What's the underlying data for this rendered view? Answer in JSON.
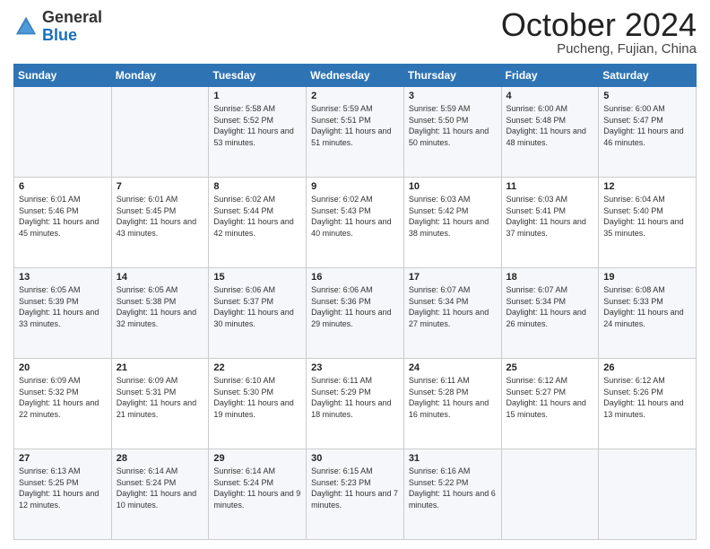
{
  "header": {
    "logo_line1": "General",
    "logo_line2": "Blue",
    "month": "October 2024",
    "location": "Pucheng, Fujian, China"
  },
  "weekdays": [
    "Sunday",
    "Monday",
    "Tuesday",
    "Wednesday",
    "Thursday",
    "Friday",
    "Saturday"
  ],
  "weeks": [
    [
      {
        "day": "",
        "info": ""
      },
      {
        "day": "",
        "info": ""
      },
      {
        "day": "1",
        "info": "Sunrise: 5:58 AM\nSunset: 5:52 PM\nDaylight: 11 hours and 53 minutes."
      },
      {
        "day": "2",
        "info": "Sunrise: 5:59 AM\nSunset: 5:51 PM\nDaylight: 11 hours and 51 minutes."
      },
      {
        "day": "3",
        "info": "Sunrise: 5:59 AM\nSunset: 5:50 PM\nDaylight: 11 hours and 50 minutes."
      },
      {
        "day": "4",
        "info": "Sunrise: 6:00 AM\nSunset: 5:48 PM\nDaylight: 11 hours and 48 minutes."
      },
      {
        "day": "5",
        "info": "Sunrise: 6:00 AM\nSunset: 5:47 PM\nDaylight: 11 hours and 46 minutes."
      }
    ],
    [
      {
        "day": "6",
        "info": "Sunrise: 6:01 AM\nSunset: 5:46 PM\nDaylight: 11 hours and 45 minutes."
      },
      {
        "day": "7",
        "info": "Sunrise: 6:01 AM\nSunset: 5:45 PM\nDaylight: 11 hours and 43 minutes."
      },
      {
        "day": "8",
        "info": "Sunrise: 6:02 AM\nSunset: 5:44 PM\nDaylight: 11 hours and 42 minutes."
      },
      {
        "day": "9",
        "info": "Sunrise: 6:02 AM\nSunset: 5:43 PM\nDaylight: 11 hours and 40 minutes."
      },
      {
        "day": "10",
        "info": "Sunrise: 6:03 AM\nSunset: 5:42 PM\nDaylight: 11 hours and 38 minutes."
      },
      {
        "day": "11",
        "info": "Sunrise: 6:03 AM\nSunset: 5:41 PM\nDaylight: 11 hours and 37 minutes."
      },
      {
        "day": "12",
        "info": "Sunrise: 6:04 AM\nSunset: 5:40 PM\nDaylight: 11 hours and 35 minutes."
      }
    ],
    [
      {
        "day": "13",
        "info": "Sunrise: 6:05 AM\nSunset: 5:39 PM\nDaylight: 11 hours and 33 minutes."
      },
      {
        "day": "14",
        "info": "Sunrise: 6:05 AM\nSunset: 5:38 PM\nDaylight: 11 hours and 32 minutes."
      },
      {
        "day": "15",
        "info": "Sunrise: 6:06 AM\nSunset: 5:37 PM\nDaylight: 11 hours and 30 minutes."
      },
      {
        "day": "16",
        "info": "Sunrise: 6:06 AM\nSunset: 5:36 PM\nDaylight: 11 hours and 29 minutes."
      },
      {
        "day": "17",
        "info": "Sunrise: 6:07 AM\nSunset: 5:34 PM\nDaylight: 11 hours and 27 minutes."
      },
      {
        "day": "18",
        "info": "Sunrise: 6:07 AM\nSunset: 5:34 PM\nDaylight: 11 hours and 26 minutes."
      },
      {
        "day": "19",
        "info": "Sunrise: 6:08 AM\nSunset: 5:33 PM\nDaylight: 11 hours and 24 minutes."
      }
    ],
    [
      {
        "day": "20",
        "info": "Sunrise: 6:09 AM\nSunset: 5:32 PM\nDaylight: 11 hours and 22 minutes."
      },
      {
        "day": "21",
        "info": "Sunrise: 6:09 AM\nSunset: 5:31 PM\nDaylight: 11 hours and 21 minutes."
      },
      {
        "day": "22",
        "info": "Sunrise: 6:10 AM\nSunset: 5:30 PM\nDaylight: 11 hours and 19 minutes."
      },
      {
        "day": "23",
        "info": "Sunrise: 6:11 AM\nSunset: 5:29 PM\nDaylight: 11 hours and 18 minutes."
      },
      {
        "day": "24",
        "info": "Sunrise: 6:11 AM\nSunset: 5:28 PM\nDaylight: 11 hours and 16 minutes."
      },
      {
        "day": "25",
        "info": "Sunrise: 6:12 AM\nSunset: 5:27 PM\nDaylight: 11 hours and 15 minutes."
      },
      {
        "day": "26",
        "info": "Sunrise: 6:12 AM\nSunset: 5:26 PM\nDaylight: 11 hours and 13 minutes."
      }
    ],
    [
      {
        "day": "27",
        "info": "Sunrise: 6:13 AM\nSunset: 5:25 PM\nDaylight: 11 hours and 12 minutes."
      },
      {
        "day": "28",
        "info": "Sunrise: 6:14 AM\nSunset: 5:24 PM\nDaylight: 11 hours and 10 minutes."
      },
      {
        "day": "29",
        "info": "Sunrise: 6:14 AM\nSunset: 5:24 PM\nDaylight: 11 hours and 9 minutes."
      },
      {
        "day": "30",
        "info": "Sunrise: 6:15 AM\nSunset: 5:23 PM\nDaylight: 11 hours and 7 minutes."
      },
      {
        "day": "31",
        "info": "Sunrise: 6:16 AM\nSunset: 5:22 PM\nDaylight: 11 hours and 6 minutes."
      },
      {
        "day": "",
        "info": ""
      },
      {
        "day": "",
        "info": ""
      }
    ]
  ]
}
